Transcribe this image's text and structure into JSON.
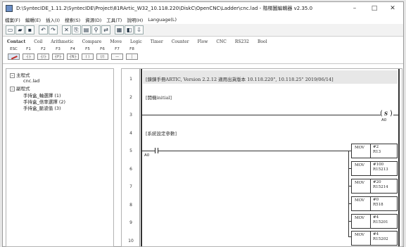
{
  "window": {
    "title": "D:\\SyntecIDE_1.11.2\\SyntecIDE\\Project\\81RArtic_W32_10.118.220\\DiskC\\OpenCNC\\Ladder\\cnc.lad - 階梯圖編輯器 v2.35.0",
    "controls": {
      "minimize": "–",
      "maximize": "□",
      "close": "✕"
    }
  },
  "menu": [
    "檔案(F)",
    "編輯(E)",
    "插入(I)",
    "搜索(S)",
    "資源(D)",
    "工具(T)",
    "說明(H)",
    "Language(L)"
  ],
  "toolbar": [
    {
      "icon": "new-file-icon",
      "glyph": "▭"
    },
    {
      "icon": "open-folder-icon",
      "glyph": "▰"
    },
    {
      "icon": "save-icon",
      "glyph": "▪"
    },
    {
      "icon": "undo-icon",
      "glyph": "↶"
    },
    {
      "icon": "redo-icon",
      "glyph": "↷"
    },
    {
      "icon": "cut-icon",
      "glyph": "✕"
    },
    {
      "icon": "copy-icon",
      "glyph": "⎘"
    },
    {
      "icon": "paste-icon",
      "glyph": "▤"
    },
    {
      "icon": "find-icon",
      "glyph": "⚲"
    },
    {
      "icon": "replace-icon",
      "glyph": "⇄"
    },
    {
      "icon": "compile-icon",
      "glyph": "▦"
    },
    {
      "icon": "monitor-icon",
      "glyph": "◧"
    },
    {
      "icon": "download-icon",
      "glyph": "⇩"
    }
  ],
  "instruction_tabs": [
    "Contact",
    "Coil",
    "Arithmetic",
    "Compare",
    "Move",
    "Logic",
    "Timer",
    "Counter",
    "Flow",
    "CNC",
    "RS232",
    "Bool"
  ],
  "fkeys": [
    {
      "label": "ESC",
      "box": ""
    },
    {
      "label": "F1",
      "box": "┤├"
    },
    {
      "label": "F2",
      "box": "┤/├"
    },
    {
      "label": "F3",
      "box": "┤P├"
    },
    {
      "label": "F4",
      "box": "┤N├"
    },
    {
      "label": "F5",
      "box": "( )"
    },
    {
      "label": "F6",
      "box": "(/)"
    },
    {
      "label": "F7",
      "box": "—"
    },
    {
      "label": "F8",
      "box": "│"
    }
  ],
  "tree": {
    "main_label": "主程式",
    "main_file": "cnc.lad",
    "sub_label": "副程式",
    "subprograms": [
      "手持盒_軸選擇 (1)",
      "手持盒_倍率選擇 (2)",
      "手持盒_脈波值 (3)"
    ]
  },
  "rungs": [
    "1",
    "2",
    "3",
    "4",
    "5",
    "6",
    "7",
    "8",
    "9",
    "10"
  ],
  "ladder": {
    "comment1": "[鍊鍊手冊ARTIC, Version 2.2.12 適用出貨版本 10.118.220\", 10.118.25\" 2019/06/14]",
    "comment2": "[開機initial]",
    "comment4": "[系統設定參數]",
    "coil_symbol": "S",
    "coil_device": "A0",
    "contact_device": "A0",
    "mov_boxes": [
      {
        "op": "MOV",
        "a": "#2",
        "b": "R13"
      },
      {
        "op": "MOV",
        "a": "#100",
        "b": "R15213"
      },
      {
        "op": "MOV",
        "a": "#20",
        "b": "R15214"
      },
      {
        "op": "MOV",
        "a": "#0",
        "b": "R518"
      },
      {
        "op": "MOV",
        "a": "#4",
        "b": "R15201"
      },
      {
        "op": "MOV",
        "a": "#4",
        "b": "R15202"
      }
    ]
  }
}
